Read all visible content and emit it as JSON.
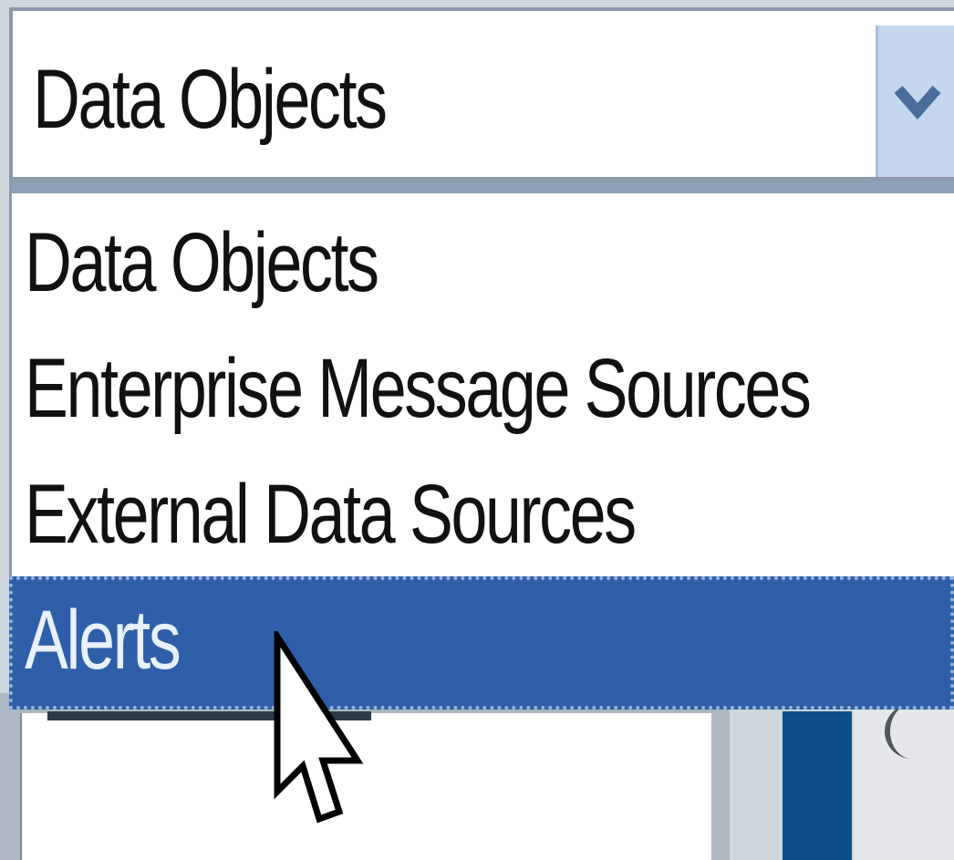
{
  "combo": {
    "selected_value": "Data Objects",
    "button_icon": "chevron-down-icon"
  },
  "dropdown": {
    "options": [
      {
        "label": "Data Objects"
      },
      {
        "label": "Enterprise Message Sources"
      },
      {
        "label": "External Data Sources"
      },
      {
        "label": "Alerts",
        "highlighted": true
      }
    ]
  },
  "pointer": {
    "icon": "mouse-cursor-icon"
  },
  "colors": {
    "highlight_bg": "#2e5fa8",
    "highlight_text": "#e9f0ff",
    "border": "#8a9aab",
    "button_bg": "#c4d7ee"
  }
}
